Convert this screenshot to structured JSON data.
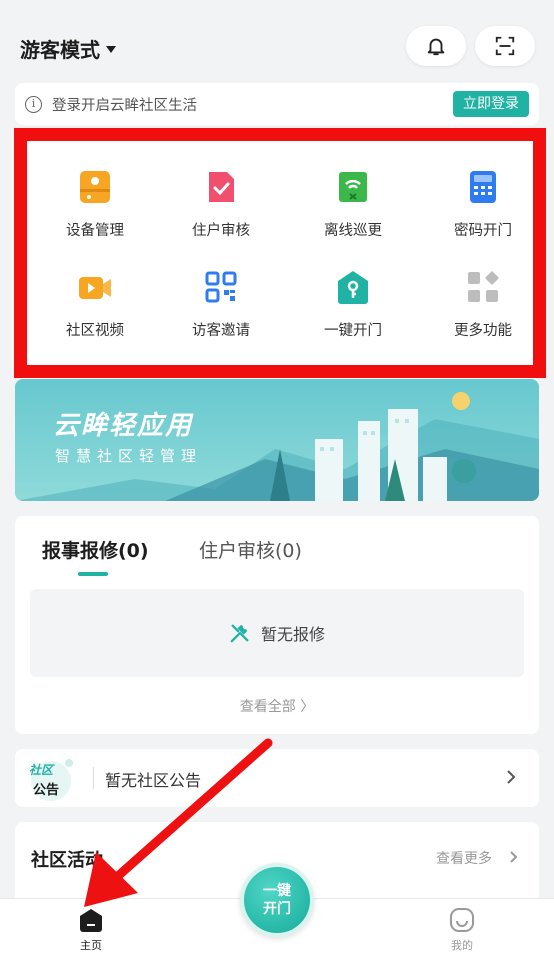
{
  "header": {
    "mode_label": "游客模式"
  },
  "login_bar": {
    "text": "登录开启云眸社区生活",
    "button": "立即登录"
  },
  "grid": [
    {
      "label": "设备管理",
      "icon": "device-manage-icon",
      "color": "#f6a623"
    },
    {
      "label": "住户审核",
      "icon": "resident-review-icon",
      "color": "#f0506e"
    },
    {
      "label": "离线巡更",
      "icon": "offline-patrol-icon",
      "color": "#3cb84b"
    },
    {
      "label": "密码开门",
      "icon": "password-door-icon",
      "color": "#2f7cf0"
    },
    {
      "label": "社区视频",
      "icon": "community-video-icon",
      "color": "#f6a623"
    },
    {
      "label": "访客邀请",
      "icon": "visitor-invite-icon",
      "color": "#2f7cf0"
    },
    {
      "label": "一键开门",
      "icon": "one-key-door-icon",
      "color": "#20b3a4"
    },
    {
      "label": "更多功能",
      "icon": "more-functions-icon",
      "color": "#bdbdbd"
    }
  ],
  "banner": {
    "title": "云眸轻应用",
    "subtitle": "智慧社区轻管理"
  },
  "repair": {
    "tab_active": "报事报修(0)",
    "tab_inactive": "住户审核(0)",
    "empty_text": "暂无报修",
    "view_all": "查看全部 〉"
  },
  "notice": {
    "badge_line1": "社区",
    "badge_line2": "公告",
    "text": "暂无社区公告"
  },
  "activity": {
    "title": "社区活动",
    "more": "查看更多"
  },
  "tabbar": {
    "home": "主页",
    "center_line1": "一键",
    "center_line2": "开门",
    "mine": "我的"
  },
  "colors": {
    "accent": "#20b3a4",
    "highlight": "#f00e0e"
  }
}
